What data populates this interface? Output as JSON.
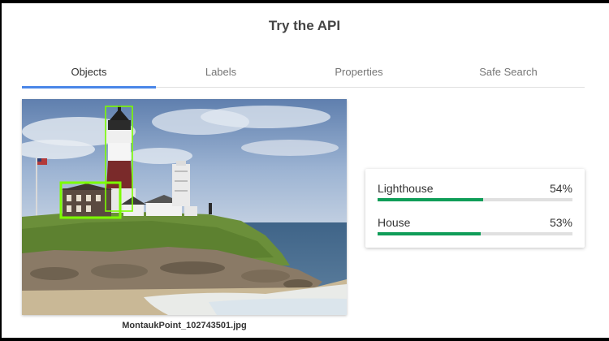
{
  "page": {
    "title": "Try the API"
  },
  "tabs": [
    {
      "label": "Objects",
      "active": true
    },
    {
      "label": "Labels",
      "active": false
    },
    {
      "label": "Properties",
      "active": false
    },
    {
      "label": "Safe Search",
      "active": false
    }
  ],
  "image": {
    "filename": "MontaukPoint_102743501.jpg"
  },
  "results": [
    {
      "label": "Lighthouse",
      "score": "54%",
      "fraction": 0.54
    },
    {
      "label": "House",
      "score": "53%",
      "fraction": 0.53
    }
  ],
  "colors": {
    "accent": "#4a86e8",
    "bar_fill": "#0f9d58",
    "box_outline": "#7cfc00"
  }
}
